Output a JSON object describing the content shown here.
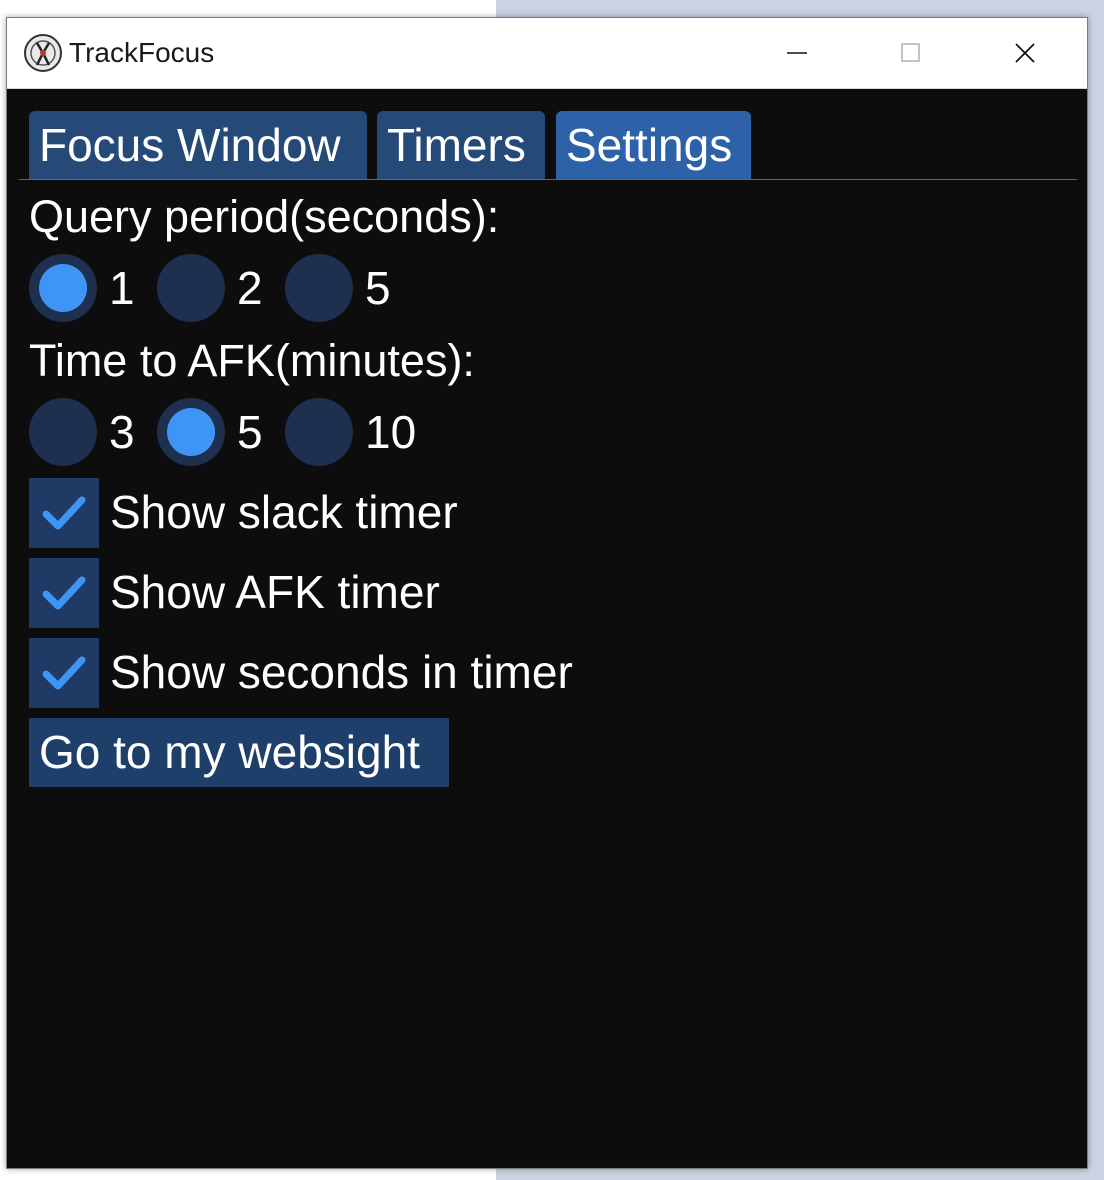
{
  "window": {
    "title": "TrackFocus",
    "icon": "app-logo-icon",
    "controls": [
      "minimize-icon",
      "maximize-icon",
      "close-icon"
    ]
  },
  "tabs": [
    {
      "label": "Focus Window",
      "active": false
    },
    {
      "label": "Timers",
      "active": false
    },
    {
      "label": "Settings",
      "active": true
    }
  ],
  "settings": {
    "query_period": {
      "label": "Query period(seconds):",
      "options": [
        "1",
        "2",
        "5"
      ],
      "selected": "1"
    },
    "afk_time": {
      "label": "Time to AFK(minutes):",
      "options": [
        "3",
        "5",
        "10"
      ],
      "selected": "5"
    },
    "checkboxes": [
      {
        "label": "Show slack timer",
        "checked": true
      },
      {
        "label": "Show AFK timer",
        "checked": true
      },
      {
        "label": "Show seconds in timer",
        "checked": true
      }
    ],
    "website_button": "Go to my websight"
  },
  "colors": {
    "background": "#0d0d0d",
    "tab_active": "#2e62a8",
    "tab_inactive": "#264a78",
    "control_bg": "#1d3050",
    "accent": "#3d95f5"
  }
}
